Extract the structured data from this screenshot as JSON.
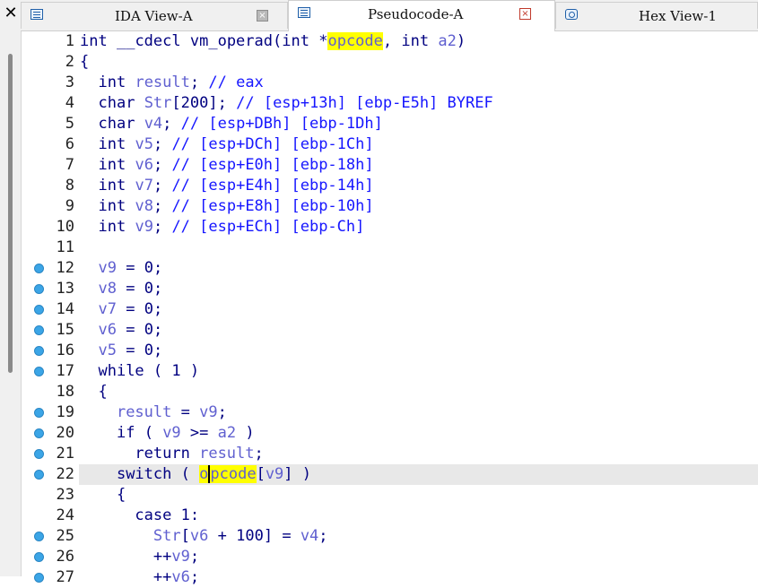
{
  "window": {
    "close_glyph": "✕"
  },
  "tabs": [
    {
      "label": "IDA View-A",
      "icon": "ida-view-icon",
      "active": false
    },
    {
      "label": "Pseudocode-A",
      "icon": "pseudocode-icon",
      "active": true
    },
    {
      "label": "Hex View-1",
      "icon": "hex-view-icon",
      "active": false
    }
  ],
  "tab_close_glyph": "×",
  "code": {
    "highlighted_word": "opcode",
    "current_line": 22,
    "lines": [
      {
        "n": "1",
        "bp": false,
        "text": "int __cdecl vm_operad(int *opcode, int a2)"
      },
      {
        "n": "2",
        "bp": false,
        "text": "{"
      },
      {
        "n": "3",
        "bp": false,
        "text": "  int result; // eax"
      },
      {
        "n": "4",
        "bp": false,
        "text": "  char Str[200]; // [esp+13h] [ebp-E5h] BYREF"
      },
      {
        "n": "5",
        "bp": false,
        "text": "  char v4; // [esp+DBh] [ebp-1Dh]"
      },
      {
        "n": "6",
        "bp": false,
        "text": "  int v5; // [esp+DCh] [ebp-1Ch]"
      },
      {
        "n": "7",
        "bp": false,
        "text": "  int v6; // [esp+E0h] [ebp-18h]"
      },
      {
        "n": "8",
        "bp": false,
        "text": "  int v7; // [esp+E4h] [ebp-14h]"
      },
      {
        "n": "9",
        "bp": false,
        "text": "  int v8; // [esp+E8h] [ebp-10h]"
      },
      {
        "n": "10",
        "bp": false,
        "text": "  int v9; // [esp+ECh] [ebp-Ch]"
      },
      {
        "n": "11",
        "bp": false,
        "text": ""
      },
      {
        "n": "12",
        "bp": true,
        "text": "  v9 = 0;"
      },
      {
        "n": "13",
        "bp": true,
        "text": "  v8 = 0;"
      },
      {
        "n": "14",
        "bp": true,
        "text": "  v7 = 0;"
      },
      {
        "n": "15",
        "bp": true,
        "text": "  v6 = 0;"
      },
      {
        "n": "16",
        "bp": true,
        "text": "  v5 = 0;"
      },
      {
        "n": "17",
        "bp": true,
        "text": "  while ( 1 )"
      },
      {
        "n": "18",
        "bp": false,
        "text": "  {"
      },
      {
        "n": "19",
        "bp": true,
        "text": "    result = v9;"
      },
      {
        "n": "20",
        "bp": true,
        "text": "    if ( v9 >= a2 )"
      },
      {
        "n": "21",
        "bp": true,
        "text": "      return result;"
      },
      {
        "n": "22",
        "bp": true,
        "text": "    switch ( opcode[v9] )"
      },
      {
        "n": "23",
        "bp": false,
        "text": "    {"
      },
      {
        "n": "24",
        "bp": false,
        "text": "      case 1:"
      },
      {
        "n": "25",
        "bp": true,
        "text": "        Str[v6 + 100] = v4;"
      },
      {
        "n": "26",
        "bp": true,
        "text": "        ++v9;"
      },
      {
        "n": "27",
        "bp": true,
        "text": "        ++v6;"
      }
    ]
  }
}
